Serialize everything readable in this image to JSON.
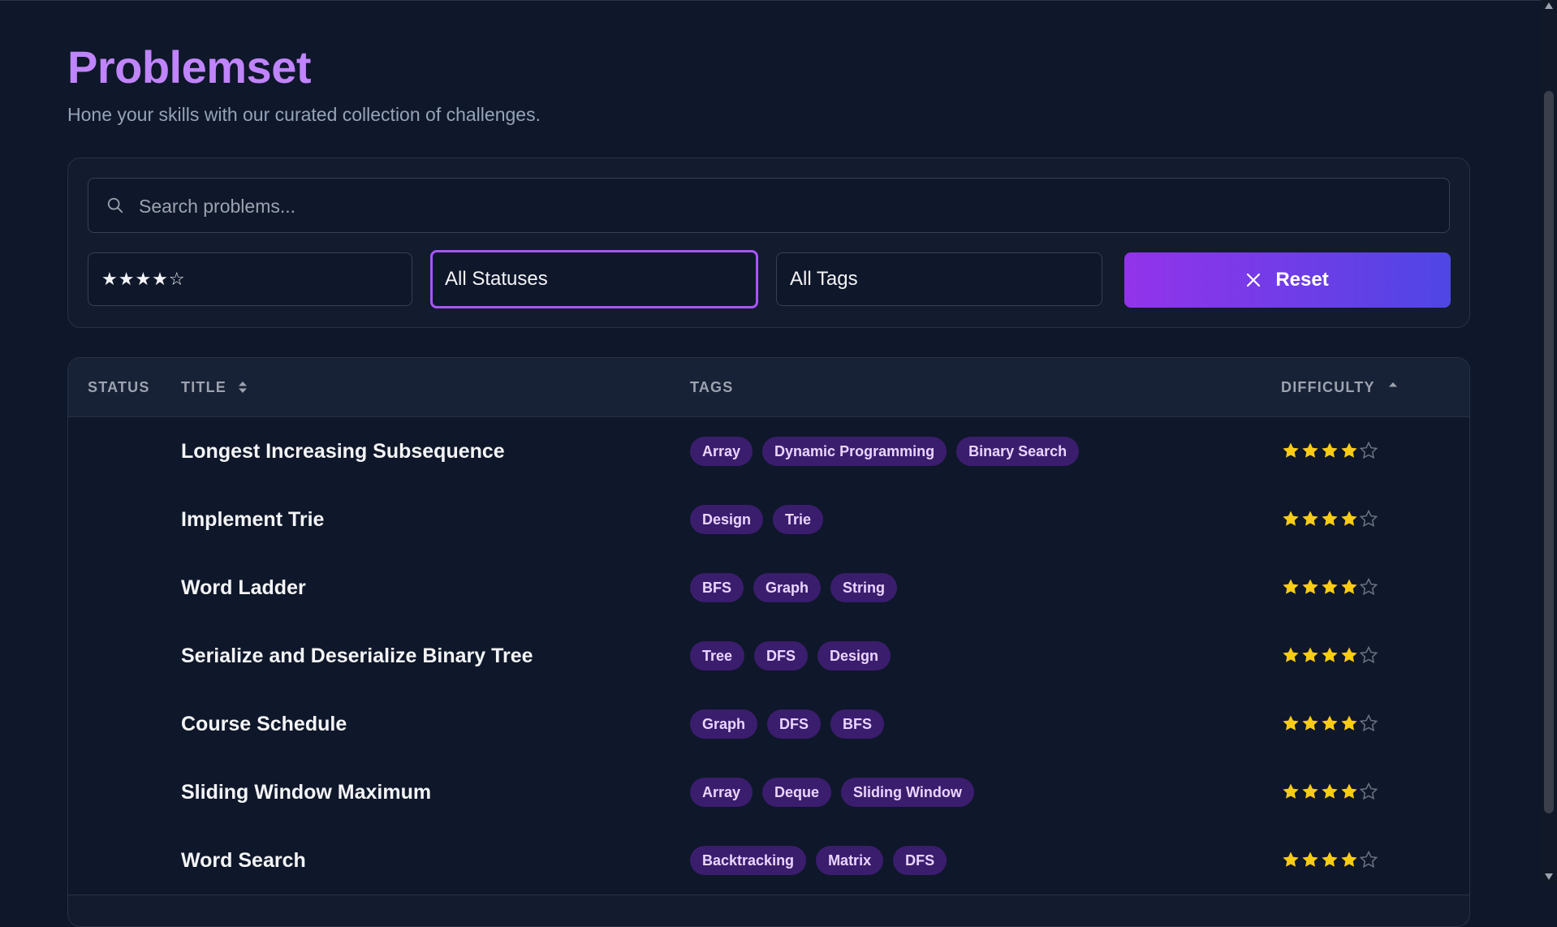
{
  "header": {
    "title": "Problemset",
    "subtitle": "Hone your skills with our curated collection of challenges."
  },
  "filters": {
    "search_placeholder": "Search problems...",
    "difficulty_value": "★★★★☆",
    "status_value": "All Statuses",
    "tags_value": "All Tags",
    "reset_label": "Reset"
  },
  "table": {
    "columns": {
      "status": "STATUS",
      "title": "TITLE",
      "tags": "TAGS",
      "difficulty": "DIFFICULTY"
    },
    "rows": [
      {
        "status": "",
        "title": "Longest Increasing Subsequence",
        "tags": [
          "Array",
          "Dynamic Programming",
          "Binary Search"
        ],
        "difficulty": 4
      },
      {
        "status": "",
        "title": "Implement Trie",
        "tags": [
          "Design",
          "Trie"
        ],
        "difficulty": 4
      },
      {
        "status": "",
        "title": "Word Ladder",
        "tags": [
          "BFS",
          "Graph",
          "String"
        ],
        "difficulty": 4
      },
      {
        "status": "",
        "title": "Serialize and Deserialize Binary Tree",
        "tags": [
          "Tree",
          "DFS",
          "Design"
        ],
        "difficulty": 4
      },
      {
        "status": "",
        "title": "Course Schedule",
        "tags": [
          "Graph",
          "DFS",
          "BFS"
        ],
        "difficulty": 4
      },
      {
        "status": "",
        "title": "Sliding Window Maximum",
        "tags": [
          "Array",
          "Deque",
          "Sliding Window"
        ],
        "difficulty": 4
      },
      {
        "status": "",
        "title": "Word Search",
        "tags": [
          "Backtracking",
          "Matrix",
          "DFS"
        ],
        "difficulty": 4
      }
    ],
    "max_difficulty": 5
  },
  "colors": {
    "accent": "#c084fc",
    "star_filled": "#facc15",
    "star_empty": "#6b7280",
    "tag_bg": "#3b1d6e"
  },
  "icons": {
    "search": "search-icon",
    "reset": "close-icon",
    "sort": "sort-icon",
    "star": "star-icon"
  }
}
